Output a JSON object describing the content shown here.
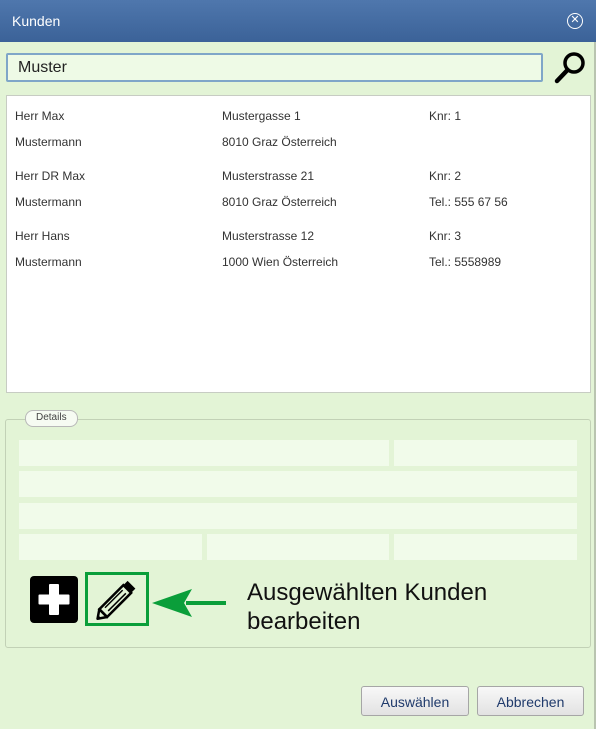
{
  "window": {
    "title": "Kunden",
    "close_icon": "close-circle-icon"
  },
  "search": {
    "value": "Muster",
    "button_icon": "search-icon"
  },
  "customers": [
    {
      "name_line1": "Herr  Max",
      "name_line2": "Mustermann",
      "street": "Mustergasse 1",
      "city": "8010 Graz Österreich",
      "info1": "Knr: 1",
      "info2": ""
    },
    {
      "name_line1": "Herr DR Max",
      "name_line2": "Mustermann",
      "street": "Musterstrasse 21",
      "city": "8010 Graz Österreich",
      "info1": "Knr: 2",
      "info2": "Tel.: 555 67 56"
    },
    {
      "name_line1": "Herr  Hans",
      "name_line2": "Mustermann",
      "street": "Musterstrasse 12",
      "city": "1000 Wien Österreich",
      "info1": "Knr: 3",
      "info2": "Tel.: 5558989"
    }
  ],
  "details": {
    "legend": "Details"
  },
  "actions": {
    "add_icon": "plus-icon",
    "edit_icon": "pencil-icon"
  },
  "annotation": {
    "line1": "Ausgewählten Kunden",
    "line2": "bearbeiten",
    "arrow_color": "#0a9e3a"
  },
  "footer": {
    "select_label": "Auswählen",
    "cancel_label": "Abbrechen"
  },
  "colors": {
    "titlebar": "#4a71a7",
    "dialog_bg": "#e3f4d6",
    "accent_green": "#0a9e3a"
  }
}
